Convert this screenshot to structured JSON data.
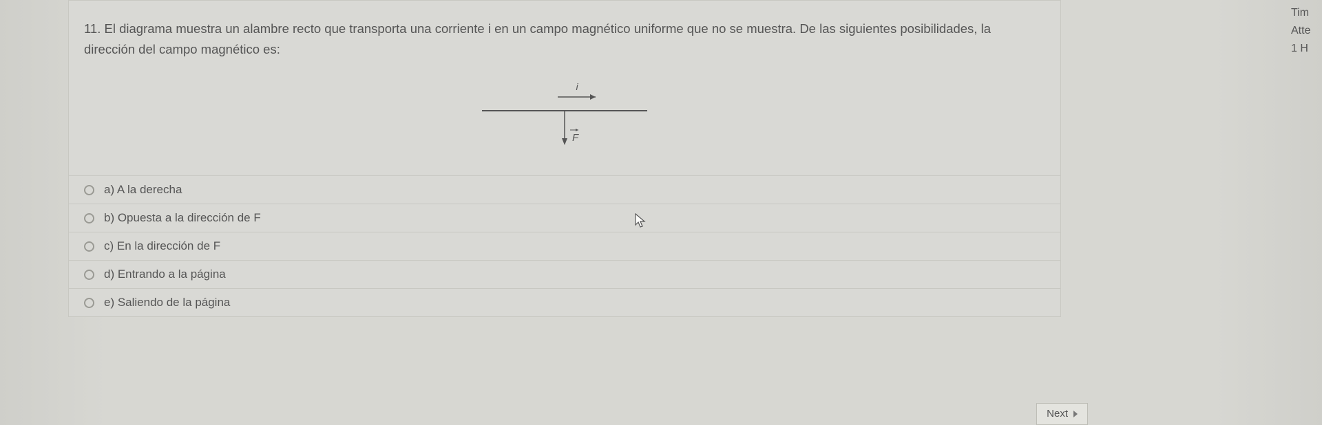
{
  "question": {
    "number": "11.",
    "text": "El diagrama muestra un alambre recto que transporta una corriente i en un campo magnético uniforme que no se muestra. De las siguientes posibilidades, la dirección del campo magnético es:"
  },
  "diagram": {
    "current_label": "i",
    "force_label": "F"
  },
  "options": [
    {
      "id": "a",
      "label": "a) A la derecha"
    },
    {
      "id": "b",
      "label": "b) Opuesta a la dirección de F"
    },
    {
      "id": "c",
      "label": "c) En la dirección de F"
    },
    {
      "id": "d",
      "label": "d) Entrando a la página"
    },
    {
      "id": "e",
      "label": "e) Saliendo de la página"
    }
  ],
  "sidebar": {
    "line1": "Tim",
    "line2": "Atte",
    "line3": "1 H"
  },
  "nav": {
    "next": "Next"
  }
}
